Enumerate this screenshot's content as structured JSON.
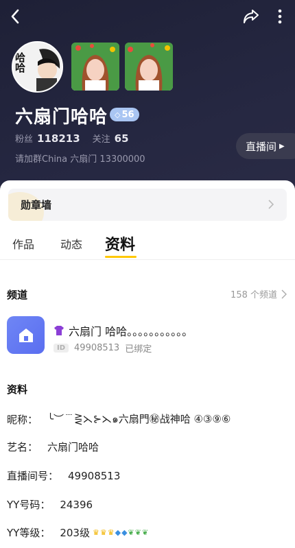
{
  "profile": {
    "avatar_text": "哈哈",
    "name": "六扇门哈哈",
    "level": "56",
    "fans_label": "粉丝",
    "fans": "118213",
    "follow_label": "关注",
    "follow": "65",
    "group_text": "请加群China 六扇门 13300000",
    "live_button": "直播间"
  },
  "medal": {
    "label": "勋章墙"
  },
  "tabs": [
    "作品",
    "动态",
    "资料"
  ],
  "channel": {
    "title": "频道",
    "count": "158 个频道",
    "name": "六扇门 哈哈。。。。。。。。。。。",
    "id_tag": "ID",
    "id": "49908513",
    "status": "已绑定"
  },
  "info": {
    "title": "资料",
    "rows": [
      {
        "key": "昵称：",
        "value": "╰︶﹉⋛⋋⊱⋋๑六扇門㊙战神哈 ④③⑨⑥"
      },
      {
        "key": "艺名：",
        "value": "六扇门哈哈"
      },
      {
        "key": "直播间号：",
        "value": "49908513"
      },
      {
        "key": "YY号码：",
        "value": "24396"
      },
      {
        "key": "YY等级：",
        "value": "203级"
      }
    ]
  },
  "colors": {
    "accent": "#ffc800",
    "header": "#1e2036",
    "channel_icon": "#6f86f5"
  }
}
